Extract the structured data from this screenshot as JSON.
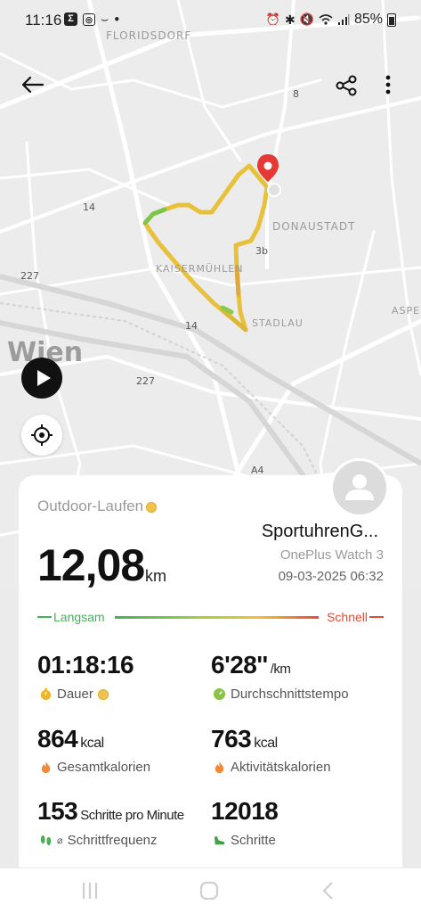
{
  "status_bar": {
    "time": "11:16",
    "battery": "85%",
    "icons": [
      "sigma-app-icon",
      "instagram-icon",
      "amazon-icon",
      "dot-icon",
      "alarm-icon",
      "bluetooth-icon",
      "mute-icon",
      "wifi-icon",
      "signal-icon",
      "battery-icon"
    ]
  },
  "map": {
    "labels": {
      "floridsdorf": "FLORIDSDORF",
      "donaustadt": "DONAUSTADT",
      "kaisermuehlen": "KAISERMÜHLEN",
      "stadlau": "STADLAU",
      "aspe": "ASPE",
      "wien": "Wien"
    },
    "road_numbers": [
      "8",
      "14",
      "3b",
      "227",
      "14",
      "227",
      "A4"
    ],
    "route_colors": {
      "slow": "#6cc24a",
      "medium": "#e6c536",
      "fast": "#e8a030"
    },
    "marker_color": "#e53935"
  },
  "header": {
    "back_icon": "arrow-left-icon",
    "share_icon": "share-icon",
    "more_icon": "more-vertical-icon"
  },
  "summary": {
    "activity_type": "Outdoor-Laufen",
    "distance": "12,08",
    "distance_unit": "km",
    "user_name": "SportuhrenG...",
    "device": "OnePlus Watch 3",
    "datetime": "09-03-2025 06:32"
  },
  "speed_legend": {
    "slow": "Langsam",
    "fast": "Schnell",
    "slow_color": "#45b25b",
    "fast_color": "#e04c35"
  },
  "stats": {
    "duration": {
      "value": "01:18:16",
      "label": "Dauer"
    },
    "pace": {
      "value": "6'28''",
      "unit": "/km",
      "label": "Durchschnittstempo"
    },
    "total_calories": {
      "value": "864",
      "unit": "kcal",
      "label": "Gesamtkalorien"
    },
    "active_calories": {
      "value": "763",
      "unit": "kcal",
      "label": "Aktivitätskalorien"
    },
    "cadence": {
      "value": "153",
      "unit": "Schritte pro Minute",
      "label": "Schrittfrequenz"
    },
    "steps": {
      "value": "12018",
      "label": "Schritte"
    }
  },
  "nav_bar": {
    "items": [
      "recents-icon",
      "home-icon",
      "back-icon"
    ]
  }
}
